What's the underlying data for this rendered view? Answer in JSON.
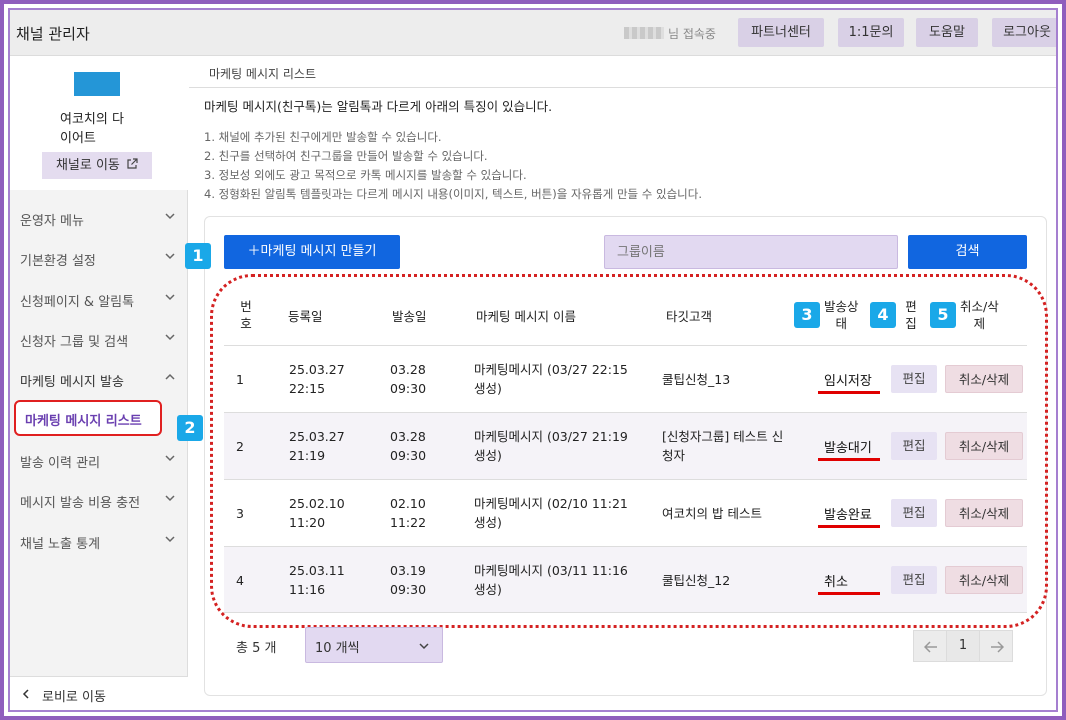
{
  "header": {
    "app_title": "채널 관리자",
    "user_status": "님 접속중",
    "buttons": [
      "파트너센터",
      "1:1문의",
      "도움말",
      "로그아웃"
    ]
  },
  "sidebar": {
    "channel_name": "여코치의 다이어트",
    "channel_name_line1": "여코치의 다",
    "channel_name_line2": "이어트",
    "move_channel": "채널로 이동",
    "items": [
      {
        "label": "운영자 메뉴",
        "expanded": false
      },
      {
        "label": "기본환경 설정",
        "expanded": false
      },
      {
        "label": "신청페이지 & 알림톡",
        "expanded": false
      },
      {
        "label": "신청자 그룹 및 검색",
        "expanded": false
      },
      {
        "label": "마케팅 메시지 발송",
        "expanded": true
      },
      {
        "label": "발송 이력 관리",
        "expanded": false
      },
      {
        "label": "메시지 발송 비용 충전",
        "expanded": false
      },
      {
        "label": "채널 노출 통계",
        "expanded": false
      }
    ],
    "active_subitem": "마케팅 메시지 리스트",
    "back": "로비로 이동"
  },
  "main": {
    "breadcrumb": "마케팅 메시지 리스트",
    "intro": "마케팅 메시지(친구톡)는 알림톡과 다르게 아래의 특징이 있습니다.",
    "notes": [
      "1. 채널에 추가된 친구에게만 발송할 수 있습니다.",
      "2. 친구를 선택하여 친구그룹을 만들어 발송할 수 있습니다.",
      "3. 정보성 외에도 광고 목적으로 카톡 메시지를 발송할 수 있습니다.",
      "4. 정형화된 알림톡 템플릿과는 다르게 메시지 내용(이미지, 텍스트, 버튼)을 자유롭게 만들 수 있습니다."
    ],
    "create_button": "＋마케팅 메시지 만들기",
    "group_placeholder": "그룹이름",
    "search_button": "검색"
  },
  "badges": [
    "1",
    "2",
    "3",
    "4",
    "5"
  ],
  "table": {
    "headers": {
      "no_1": "번",
      "no_2": "호",
      "reg_date": "등록일",
      "send_date": "발송일",
      "name": "마케팅 메시지 이름",
      "target": "타깃고객",
      "status_1": "발송상",
      "status_2": "태",
      "edit_1": "편",
      "edit_2": "집",
      "cancel_1": "취소/삭",
      "cancel_2": "제"
    },
    "rows": [
      {
        "no": "1",
        "reg_date": "25.03.27",
        "reg_time": "22:15",
        "send_date": "03.28",
        "send_time": "09:30",
        "name_1": "마케팅메시지 (03/27 22:15",
        "name_2": "생성)",
        "target_1": "쿨팁신청_13",
        "target_2": "",
        "status": "임시저장",
        "edit": "편집",
        "cancel": "취소/삭제"
      },
      {
        "no": "2",
        "reg_date": "25.03.27",
        "reg_time": "21:19",
        "send_date": "03.28",
        "send_time": "09:30",
        "name_1": "마케팅메시지 (03/27 21:19",
        "name_2": "생성)",
        "target_1": "[신청자그룹] 테스트 신",
        "target_2": "청자",
        "status": "발송대기",
        "edit": "편집",
        "cancel": "취소/삭제"
      },
      {
        "no": "3",
        "reg_date": "25.02.10",
        "reg_time": "11:20",
        "send_date": "02.10",
        "send_time": "11:22",
        "name_1": "마케팅메시지 (02/10 11:21",
        "name_2": "생성)",
        "target_1": "여코치의 밥 테스트",
        "target_2": "",
        "status": "발송완료",
        "edit": "편집",
        "cancel": "취소/삭제"
      },
      {
        "no": "4",
        "reg_date": "25.03.11",
        "reg_time": "11:16",
        "send_date": "03.19",
        "send_time": "09:30",
        "name_1": "마케팅메시지 (03/11 11:16",
        "name_2": "생성)",
        "target_1": "쿨팁신청_12",
        "target_2": "",
        "status": "취소",
        "edit": "편집",
        "cancel": "취소/삭제"
      }
    ]
  },
  "footer": {
    "total": "총 5 개",
    "per_page": "10 개씩",
    "current_page": "1"
  },
  "colors": {
    "frame": "#8f5dbd",
    "primary": "#1166e0",
    "badge": "#1aa8e8",
    "highlight": "#e02020"
  }
}
